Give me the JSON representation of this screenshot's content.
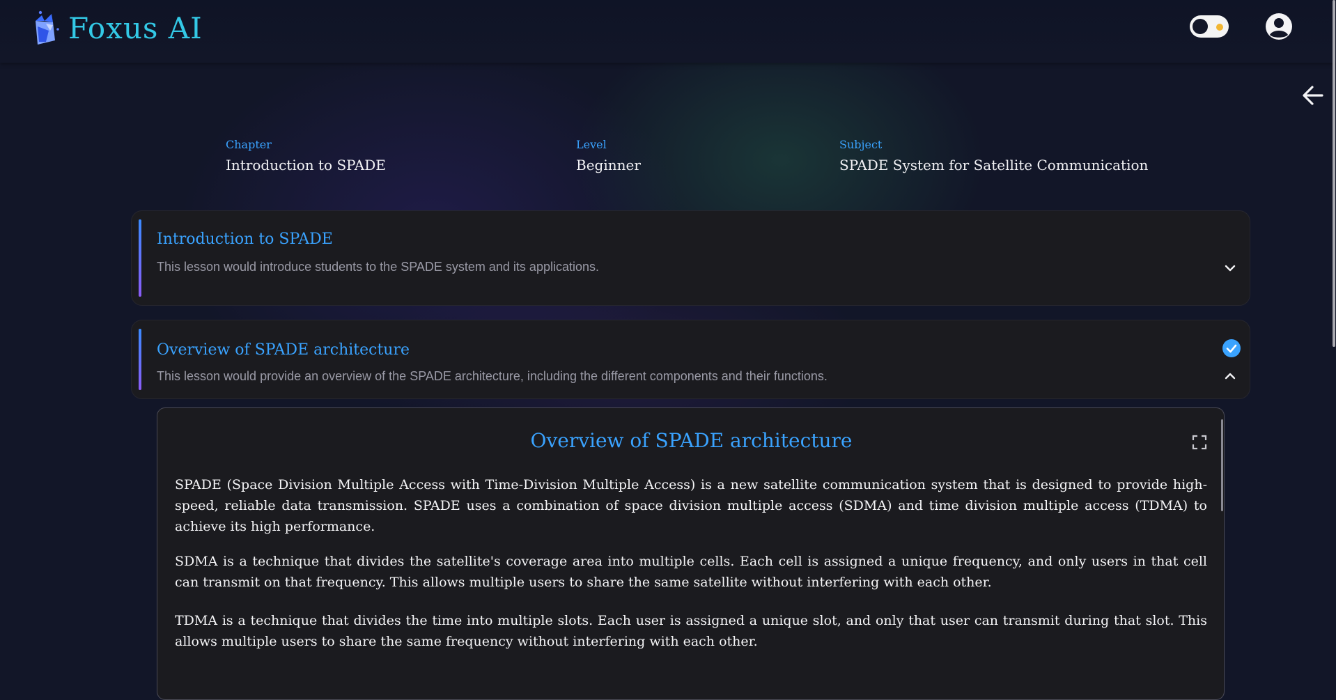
{
  "app": {
    "name": "Foxus AI"
  },
  "header": {
    "theme_toggle": "theme-toggle",
    "account": "account-icon"
  },
  "meta": {
    "chapter_label": "Chapter",
    "chapter_value": "Introduction to SPADE",
    "level_label": "Level",
    "level_value": "Beginner",
    "subject_label": "Subject",
    "subject_value": "SPADE System for Satellite Communication"
  },
  "lessons": [
    {
      "title": "Introduction to SPADE",
      "description": "This lesson would introduce students to the SPADE system and its applications.",
      "completed": false,
      "expanded": false
    },
    {
      "title": "Overview of SPADE architecture",
      "description": "This lesson would provide an overview of the SPADE architecture, including the different components and their functions.",
      "completed": true,
      "expanded": true
    }
  ],
  "content": {
    "title": "Overview of SPADE architecture",
    "paragraphs": [
      "SPADE (Space Division Multiple Access with Time-Division Multiple Access) is a new satellite communication system that is designed to provide high-speed, reliable data transmission. SPADE uses a combination of space division multiple access (SDMA) and time division multiple access (TDMA) to achieve its high performance.",
      "SDMA is a technique that divides the satellite's coverage area into multiple cells. Each cell is assigned a unique frequency, and only users in that cell can transmit on that frequency. This allows multiple users to share the same satellite without interfering with each other.",
      "TDMA is a technique that divides the time into multiple slots. Each user is assigned a unique slot, and only that user can transmit during that slot. This allows multiple users to share the same frequency without interfering with each other."
    ]
  },
  "colors": {
    "accent": "#3aa3ff",
    "logo": "#33c9e6",
    "background": "#121628",
    "card": "#1b1b1f"
  }
}
